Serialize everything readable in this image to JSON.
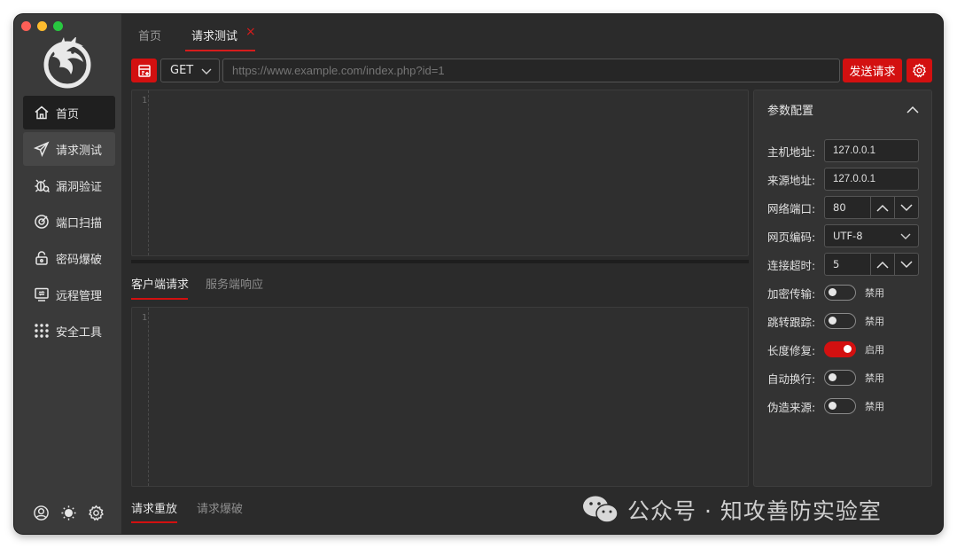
{
  "top_tabs": [
    {
      "label": "首页",
      "active": false
    },
    {
      "label": "请求测试",
      "active": true,
      "close": "×"
    }
  ],
  "sidebar": {
    "items": [
      {
        "label": "首页",
        "icon": "home-icon",
        "state": "active"
      },
      {
        "label": "请求测试",
        "icon": "send-icon",
        "state": "hover"
      },
      {
        "label": "漏洞验证",
        "icon": "bug-icon",
        "state": ""
      },
      {
        "label": "端口扫描",
        "icon": "radar-icon",
        "state": ""
      },
      {
        "label": "密码爆破",
        "icon": "lock-icon",
        "state": ""
      },
      {
        "label": "远程管理",
        "icon": "monitor-icon",
        "state": ""
      },
      {
        "label": "安全工具",
        "icon": "grid-icon",
        "state": ""
      }
    ],
    "bottom_icons": [
      "user-icon",
      "sun-icon",
      "settings-icon"
    ]
  },
  "request": {
    "method": "GET",
    "url_placeholder": "https://www.example.com/index.php?id=1",
    "send_label": "发送请求"
  },
  "editor_top": {
    "line": "1"
  },
  "editor_bottom": {
    "line": "1"
  },
  "mid_tabs": [
    {
      "label": "客户端请求",
      "active": true
    },
    {
      "label": "服务端响应",
      "active": false
    }
  ],
  "bottom_tabs": [
    {
      "label": "请求重放",
      "active": true
    },
    {
      "label": "请求爆破",
      "active": false
    }
  ],
  "params": {
    "title": "参数配置",
    "host_label": "主机地址:",
    "host_value": "127.0.0.1",
    "origin_label": "来源地址:",
    "origin_value": "127.0.0.1",
    "port_label": "网络端口:",
    "port_value": "80",
    "encoding_label": "网页编码:",
    "encoding_value": "UTF-8",
    "timeout_label": "连接超时:",
    "timeout_value": "5",
    "toggles": [
      {
        "label": "加密传输:",
        "state": "禁用",
        "on": false
      },
      {
        "label": "跳转跟踪:",
        "state": "禁用",
        "on": false
      },
      {
        "label": "长度修复:",
        "state": "启用",
        "on": true
      },
      {
        "label": "自动换行:",
        "state": "禁用",
        "on": false
      },
      {
        "label": "伪造来源:",
        "state": "禁用",
        "on": false
      }
    ]
  },
  "watermark": {
    "text": "公众号 · 知攻善防实验室"
  },
  "colors": {
    "accent": "#d31010",
    "bg": "#2b2b2b",
    "sidebar": "#3a3a3a"
  }
}
